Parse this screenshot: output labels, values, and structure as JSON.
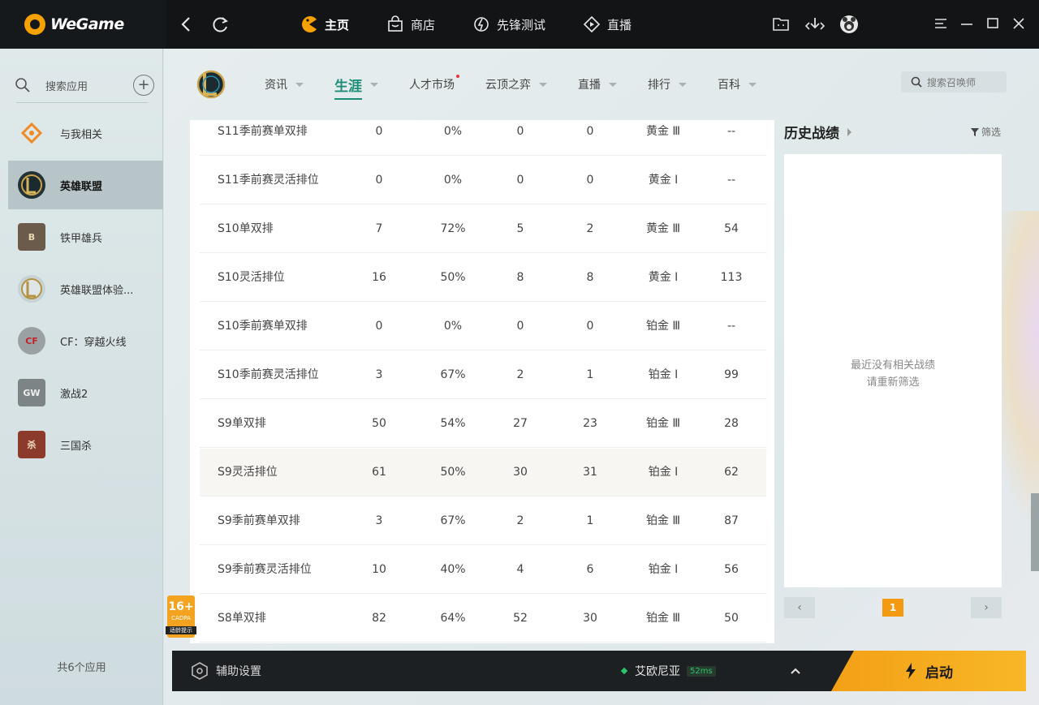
{
  "brand": {
    "name": "WeGame"
  },
  "topnav": [
    {
      "label": "主页",
      "icon": "home-pacman-icon",
      "active": true
    },
    {
      "label": "商店",
      "icon": "store-bag-icon",
      "active": false
    },
    {
      "label": "先锋测试",
      "icon": "pioneer-test-icon",
      "active": false
    },
    {
      "label": "直播",
      "icon": "live-stream-icon",
      "active": false
    }
  ],
  "sidebar": {
    "search_label": "搜索应用",
    "apps": [
      {
        "label": "与我相关",
        "icon": "related-icon",
        "active": false
      },
      {
        "label": "英雄联盟",
        "icon": "league-of-legends-icon",
        "active": true
      },
      {
        "label": "铁甲雄兵",
        "icon": "iron-troops-icon",
        "active": false
      },
      {
        "label": "英雄联盟体验...",
        "icon": "lol-pbe-icon",
        "active": false
      },
      {
        "label": "CF：穿越火线",
        "icon": "crossfire-icon",
        "active": false
      },
      {
        "label": "激战2",
        "icon": "guild-wars-2-icon",
        "active": false
      },
      {
        "label": "三国杀",
        "icon": "sanguosha-icon",
        "active": false
      }
    ],
    "count_label": "共6个应用"
  },
  "subnav": {
    "tabs": [
      {
        "label": "资讯",
        "active": false,
        "caret": true,
        "dot": false
      },
      {
        "label": "生涯",
        "active": true,
        "caret": true,
        "dot": false
      },
      {
        "label": "人才市场",
        "active": false,
        "caret": false,
        "dot": true
      },
      {
        "label": "云顶之弈",
        "active": false,
        "caret": true,
        "dot": false
      },
      {
        "label": "直播",
        "active": false,
        "caret": true,
        "dot": false
      },
      {
        "label": "排行",
        "active": false,
        "caret": true,
        "dot": false
      },
      {
        "label": "百科",
        "active": false,
        "caret": true,
        "dot": false
      }
    ],
    "search_placeholder": "搜索召唤师"
  },
  "rank_table": {
    "rows": [
      {
        "mode": "S11季前赛单双排",
        "games": "0",
        "winrate": "0%",
        "wins": "0",
        "losses": "0",
        "rank": "黄金 Ⅲ",
        "points": "--"
      },
      {
        "mode": "S11季前赛灵活排位",
        "games": "0",
        "winrate": "0%",
        "wins": "0",
        "losses": "0",
        "rank": "黄金 Ⅰ",
        "points": "--"
      },
      {
        "mode": "S10单双排",
        "games": "7",
        "winrate": "72%",
        "wins": "5",
        "losses": "2",
        "rank": "黄金 Ⅲ",
        "points": "54"
      },
      {
        "mode": "S10灵活排位",
        "games": "16",
        "winrate": "50%",
        "wins": "8",
        "losses": "8",
        "rank": "黄金 Ⅰ",
        "points": "113"
      },
      {
        "mode": "S10季前赛单双排",
        "games": "0",
        "winrate": "0%",
        "wins": "0",
        "losses": "0",
        "rank": "铂金 Ⅲ",
        "points": "--"
      },
      {
        "mode": "S10季前赛灵活排位",
        "games": "3",
        "winrate": "67%",
        "wins": "2",
        "losses": "1",
        "rank": "铂金 Ⅰ",
        "points": "99"
      },
      {
        "mode": "S9单双排",
        "games": "50",
        "winrate": "54%",
        "wins": "27",
        "losses": "23",
        "rank": "铂金 Ⅲ",
        "points": "28"
      },
      {
        "mode": "S9灵活排位",
        "games": "61",
        "winrate": "50%",
        "wins": "30",
        "losses": "31",
        "rank": "铂金 Ⅰ",
        "points": "62"
      },
      {
        "mode": "S9季前赛单双排",
        "games": "3",
        "winrate": "67%",
        "wins": "2",
        "losses": "1",
        "rank": "铂金 Ⅲ",
        "points": "87"
      },
      {
        "mode": "S9季前赛灵活排位",
        "games": "10",
        "winrate": "40%",
        "wins": "4",
        "losses": "6",
        "rank": "铂金 Ⅰ",
        "points": "56"
      },
      {
        "mode": "S8单双排",
        "games": "82",
        "winrate": "64%",
        "wins": "52",
        "losses": "30",
        "rank": "铂金 Ⅲ",
        "points": "50"
      }
    ],
    "highlighted_row": "S9灵活排位"
  },
  "age_rating": {
    "value": "16+",
    "sub": "CADPA",
    "note": "适龄提示"
  },
  "history": {
    "title": "历史战绩",
    "filter_label": "筛选",
    "empty_line1": "最近没有相关战绩",
    "empty_line2": "请重新筛选",
    "current_page": "1"
  },
  "bottombar": {
    "assist_label": "辅助设置",
    "server_name": "艾欧尼亚",
    "ping": "52ms",
    "launch_label": "启动"
  },
  "colors": {
    "accent_green": "#1e8d77",
    "launch_orange": "#f3a016",
    "topbar_bg": "#121416",
    "ping_green": "#2cc36b"
  }
}
